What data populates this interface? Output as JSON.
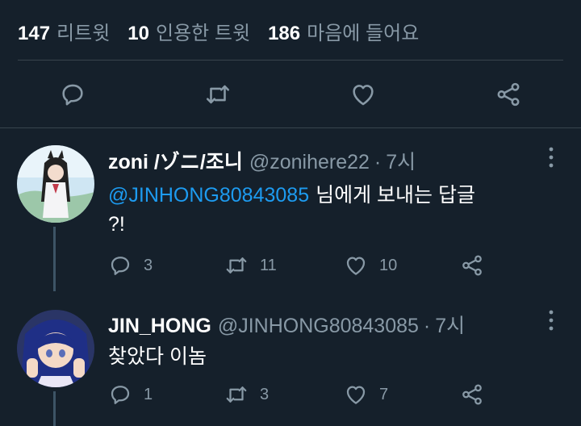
{
  "stats": [
    {
      "count": "147",
      "label": "리트윗"
    },
    {
      "count": "10",
      "label": "인용한 트윗"
    },
    {
      "count": "186",
      "label": "마음에 들어요"
    }
  ],
  "colors": {
    "background": "#15202b",
    "secondary_text": "#8899a6",
    "mention": "#1d9bf0",
    "divider": "#38444d"
  },
  "actions": {
    "reply": "reply-icon",
    "retweet": "retweet-icon",
    "like": "heart-icon",
    "share": "share-icon"
  },
  "replies": [
    {
      "name": "zoni /ゾニ/조니",
      "handle": "@zonihere22",
      "separator": "·",
      "time": "7시",
      "reply_to_mention": "@JINHONG80843085",
      "reply_to_rest": "님에게 보내는 답글",
      "text": "?!",
      "reply_count": "3",
      "retweet_count": "11",
      "like_count": "10"
    },
    {
      "name": "JIN_HONG",
      "handle": "@JINHONG80843085",
      "separator": "·",
      "time": "7시",
      "text": "찾았다 이놈",
      "reply_count": "1",
      "retweet_count": "3",
      "like_count": "7"
    }
  ]
}
